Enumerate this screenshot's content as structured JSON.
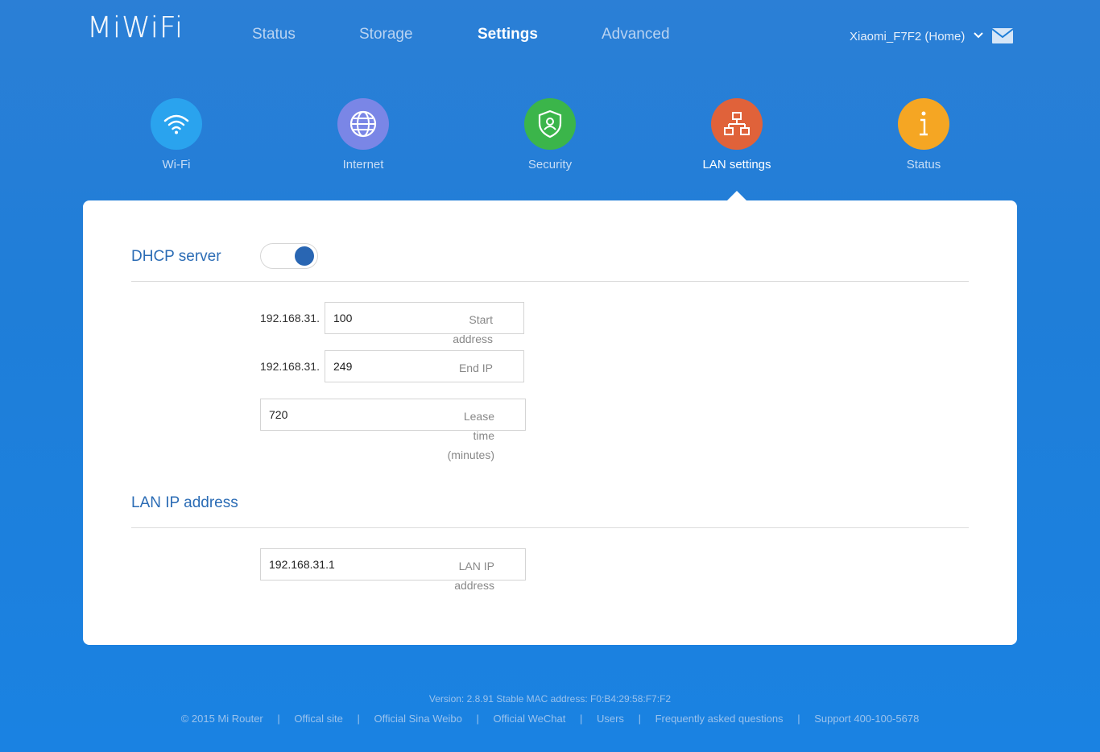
{
  "logo": "MiWiFi",
  "nav": {
    "items": [
      {
        "label": "Status"
      },
      {
        "label": "Storage"
      },
      {
        "label": "Settings"
      },
      {
        "label": "Advanced"
      }
    ],
    "active": "Settings"
  },
  "router": {
    "name": "Xiaomi_F7F2 (Home)"
  },
  "categories": [
    {
      "label": "Wi-Fi",
      "color": "#2aa3ee",
      "icon": "wifi-icon"
    },
    {
      "label": "Internet",
      "color": "#7a86e6",
      "icon": "globe-icon"
    },
    {
      "label": "Security",
      "color": "#3bb54a",
      "icon": "shield-icon"
    },
    {
      "label": "LAN settings",
      "color": "#e0623a",
      "icon": "network-icon"
    },
    {
      "label": "Status",
      "color": "#f5a623",
      "icon": "info-icon"
    }
  ],
  "dhcp": {
    "title": "DHCP server",
    "enabled": true,
    "prefix": "192.168.31.",
    "start": {
      "value": "100",
      "placeholder": "Start\naddress"
    },
    "end": {
      "value": "249",
      "placeholder": "End IP"
    },
    "lease": {
      "value": "720",
      "placeholder": "Lease\ntime\n(minutes)"
    }
  },
  "lan": {
    "title": "LAN IP address",
    "ip": {
      "value": "192.168.31.1",
      "placeholder": "LAN IP\naddress"
    }
  },
  "footer": {
    "version": "Version: 2.8.91 Stable  MAC address: F0:B4:29:58:F7:F2",
    "links": [
      "© 2015 Mi Router",
      "Offical site",
      "Official Sina Weibo",
      "Official WeChat",
      "Users",
      "Frequently asked questions",
      "Support 400-100-5678"
    ],
    "separator": "|"
  },
  "colors": {
    "background": "#1f7ed8",
    "accent": "#2b6cb5",
    "toggle_on": "#2966b3"
  }
}
